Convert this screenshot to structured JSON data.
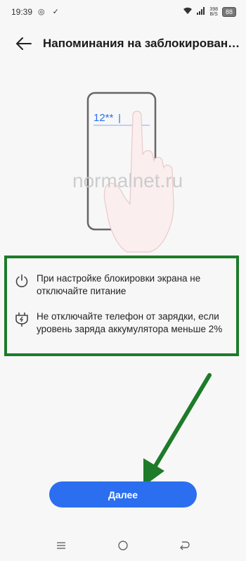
{
  "status_bar": {
    "time": "19:39",
    "left_icons": "◎ ✓",
    "net_speed_value": "398",
    "net_speed_unit": "B/S",
    "battery": "88"
  },
  "header": {
    "title": "Напоминания на заблокирован…"
  },
  "illustration": {
    "pin_text": "12**"
  },
  "watermark": "normalnet.ru",
  "instructions": [
    {
      "icon": "power-icon",
      "text": "При настройке блокировки экрана не отключайте питание"
    },
    {
      "icon": "charging-plug-icon",
      "text": "Не отключайте телефон от зарядки, если уровень заряда аккумулятора меньше 2%"
    }
  ],
  "next_button": {
    "label": "Далее"
  },
  "colors": {
    "accent": "#2b6ff0",
    "annotation_green": "#1d7b2a",
    "background": "#f7f7f7"
  },
  "nav_bar": {
    "icons": [
      "menu-icon",
      "home-icon",
      "back-nav-icon"
    ]
  }
}
